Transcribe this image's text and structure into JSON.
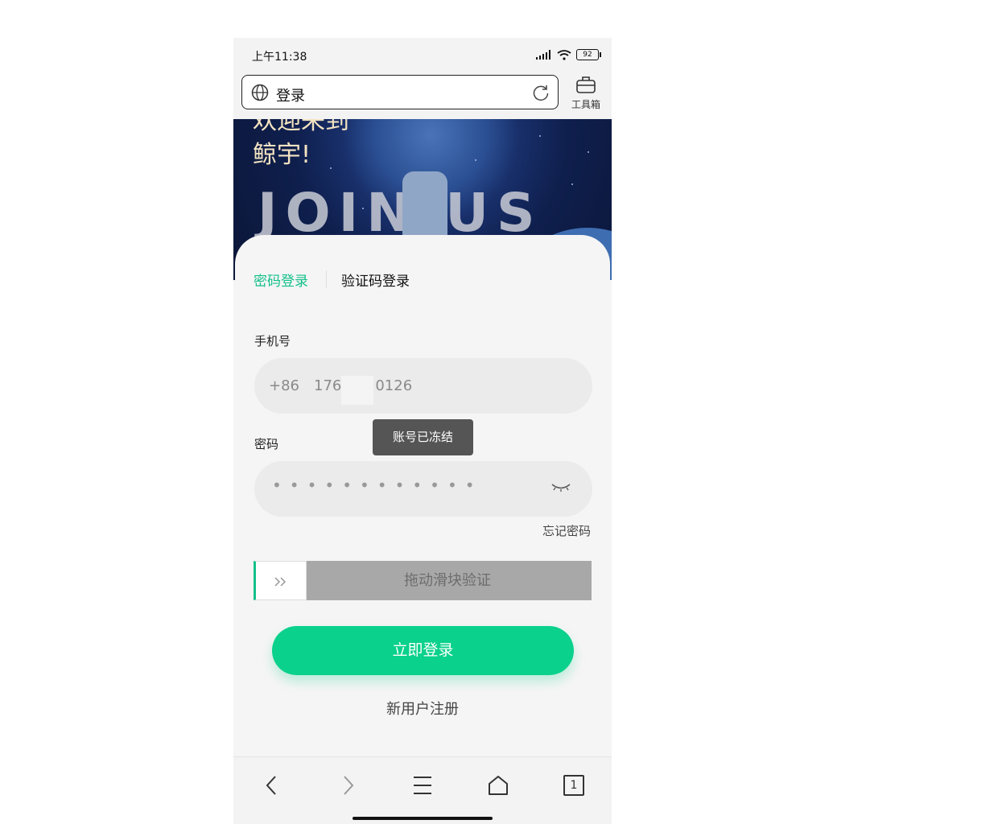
{
  "statusbar": {
    "time": "上午11:38",
    "battery": "92"
  },
  "addressbar": {
    "title": "登录",
    "toolbox_label": "工具箱"
  },
  "banner": {
    "welcome_line1": "欢迎来到",
    "welcome_line2": "鲸宇!",
    "join_text": "JOIN  US"
  },
  "tabs": [
    {
      "label": "密码登录",
      "active": true
    },
    {
      "label": "验证码登录",
      "active": false
    }
  ],
  "form": {
    "phone_label": "手机号",
    "phone_prefix": "+86",
    "phone_value_start": "176",
    "phone_value_end": "0126",
    "password_label": "密码",
    "password_mask": "••••••••••••",
    "forgot_label": "忘记密码",
    "slider_text": "拖动滑块验证",
    "login_label": "立即登录",
    "register_label": "新用户注册"
  },
  "toast": {
    "message": "账号已冻结"
  },
  "nav": {
    "tabs_count": "1"
  },
  "colors": {
    "accent": "#0ad18c",
    "tab_active": "#13c08a",
    "toast_bg": "#555555"
  }
}
